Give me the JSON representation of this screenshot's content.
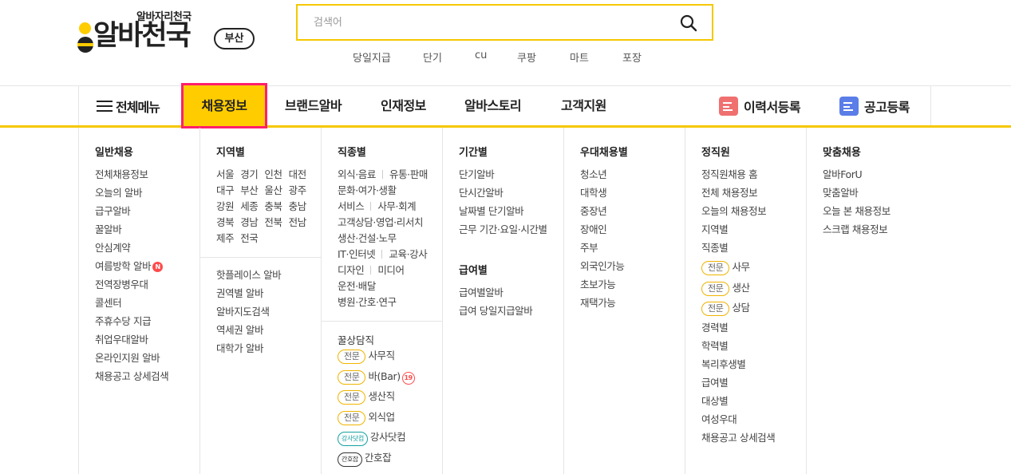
{
  "logo": {
    "tagline": "알바자리천국",
    "name": "알바천국",
    "region": "부산"
  },
  "search": {
    "placeholder": "검색어"
  },
  "keywords": [
    "당일지급",
    "단기",
    "cu",
    "쿠팡",
    "마트",
    "포장"
  ],
  "nav": {
    "menu_all": "전체메뉴",
    "items": [
      "채용정보",
      "브랜드알바",
      "인재정보",
      "알바스토리",
      "고객지원"
    ],
    "resume": "이력서등록",
    "post": "공고등록"
  },
  "mega": {
    "general": {
      "title": "일반채용",
      "items": [
        "전체채용정보",
        "오늘의 알바",
        "급구알바",
        "꿀알바",
        "안심계약",
        "여름방학 알바",
        "전역장병우대",
        "콜센터",
        "주휴수당 지급",
        "취업우대알바",
        "온라인지원 알바",
        "채용공고 상세검색"
      ],
      "new_badge": "N"
    },
    "region": {
      "title": "지역별",
      "rows": [
        [
          "서울",
          "경기",
          "인천",
          "대전"
        ],
        [
          "대구",
          "부산",
          "울산",
          "광주"
        ],
        [
          "강원",
          "세종",
          "충북",
          "충남"
        ],
        [
          "경북",
          "경남",
          "전북",
          "전남"
        ],
        [
          "제주",
          "전국"
        ]
      ],
      "items": [
        "핫플레이스 알바",
        "권역별 알바",
        "알바지도검색",
        "역세권 알바",
        "대학가 알바"
      ]
    },
    "job": {
      "title": "직종별",
      "rows": [
        [
          "외식·음료",
          "유통·판매"
        ],
        [
          "문화·여가·생활"
        ],
        [
          "서비스",
          "사무·회계"
        ],
        [
          "고객상담·영업·리서치"
        ],
        [
          "생산·건설·노무"
        ],
        [
          "IT·인터넷",
          "교육·강사"
        ],
        [
          "디자인",
          "미디어"
        ],
        [
          "운전·배달"
        ],
        [
          "병원·간호·연구"
        ]
      ],
      "honey_title": "꿀상담직",
      "honey_items": [
        {
          "tag": "전문",
          "label": "사무직"
        },
        {
          "tag": "전문",
          "label": "바(Bar)",
          "badge": "19"
        },
        {
          "tag": "전문",
          "label": "생산직"
        },
        {
          "tag": "전문",
          "label": "외식업"
        },
        {
          "tag": "강사닷컴",
          "label": "강사닷컴"
        },
        {
          "tag": "간호잡",
          "label": "간호잡"
        }
      ]
    },
    "period": {
      "title": "기간별",
      "items": [
        "단기알바",
        "단시간알바",
        "날짜별 단기알바",
        "근무 기간·요일·시간별"
      ],
      "pay_title": "급여별",
      "pay_items": [
        "급여별알바",
        "급여 당일지급알바"
      ]
    },
    "preferred": {
      "title": "우대채용별",
      "items": [
        "청소년",
        "대학생",
        "중장년",
        "장애인",
        "주부",
        "외국인가능",
        "초보가능",
        "재택가능"
      ]
    },
    "fulltime": {
      "title": "정직원",
      "items_a": [
        "정직원채용 홈",
        "전체 채용정보",
        "오늘의 채용정보",
        "지역별",
        "직종별"
      ],
      "tagged": [
        {
          "tag": "전문",
          "label": "사무"
        },
        {
          "tag": "전문",
          "label": "생산"
        },
        {
          "tag": "전문",
          "label": "상담"
        }
      ],
      "items_b": [
        "경력별",
        "학력별",
        "복리후생별",
        "급여별",
        "대상별",
        "여성우대",
        "채용공고 상세검색"
      ]
    },
    "custom": {
      "title": "맞춤채용",
      "items": [
        "알바ForU",
        "맞춤알바",
        "오늘 본 채용정보",
        "스크랩 채용정보"
      ]
    }
  },
  "colors": {
    "brand_yellow": "#ffcc00",
    "active_border": "#ff1f6b",
    "resume_icon": "#f07070",
    "post_icon": "#5a7de8"
  }
}
